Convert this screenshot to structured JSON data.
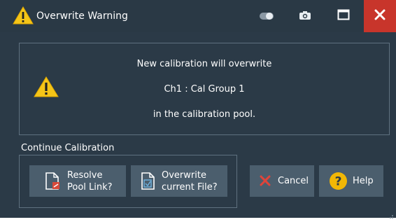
{
  "window": {
    "title": "Overwrite Warning",
    "icons": {
      "title": "warning-triangle-icon",
      "toggle": "toggle-icon",
      "camera": "camera-icon",
      "maximize": "maximize-icon",
      "close": "close-icon"
    }
  },
  "message": {
    "line1": "New calibration will overwrite",
    "line2": "Ch1 : Cal Group 1",
    "line3": "in the calibration pool.",
    "icon": "warning-triangle-icon"
  },
  "continue_group": {
    "label": "Continue Calibration",
    "resolve": {
      "line1": "Resolve",
      "line2": "Pool Link?",
      "icon": "file-link-icon"
    },
    "overwrite": {
      "line1": "Overwrite",
      "line2": "current File?",
      "icon": "file-overwrite-icon"
    }
  },
  "actions": {
    "cancel": {
      "label": "Cancel",
      "icon": "x-icon"
    },
    "help": {
      "label": "Help",
      "icon": "question-icon"
    }
  },
  "colors": {
    "background": "#2b3a47",
    "button": "#4b5e6d",
    "close": "#c8352b",
    "warning": "#f5c518",
    "cancel_x": "#e0443a",
    "help": "#f2b705"
  }
}
